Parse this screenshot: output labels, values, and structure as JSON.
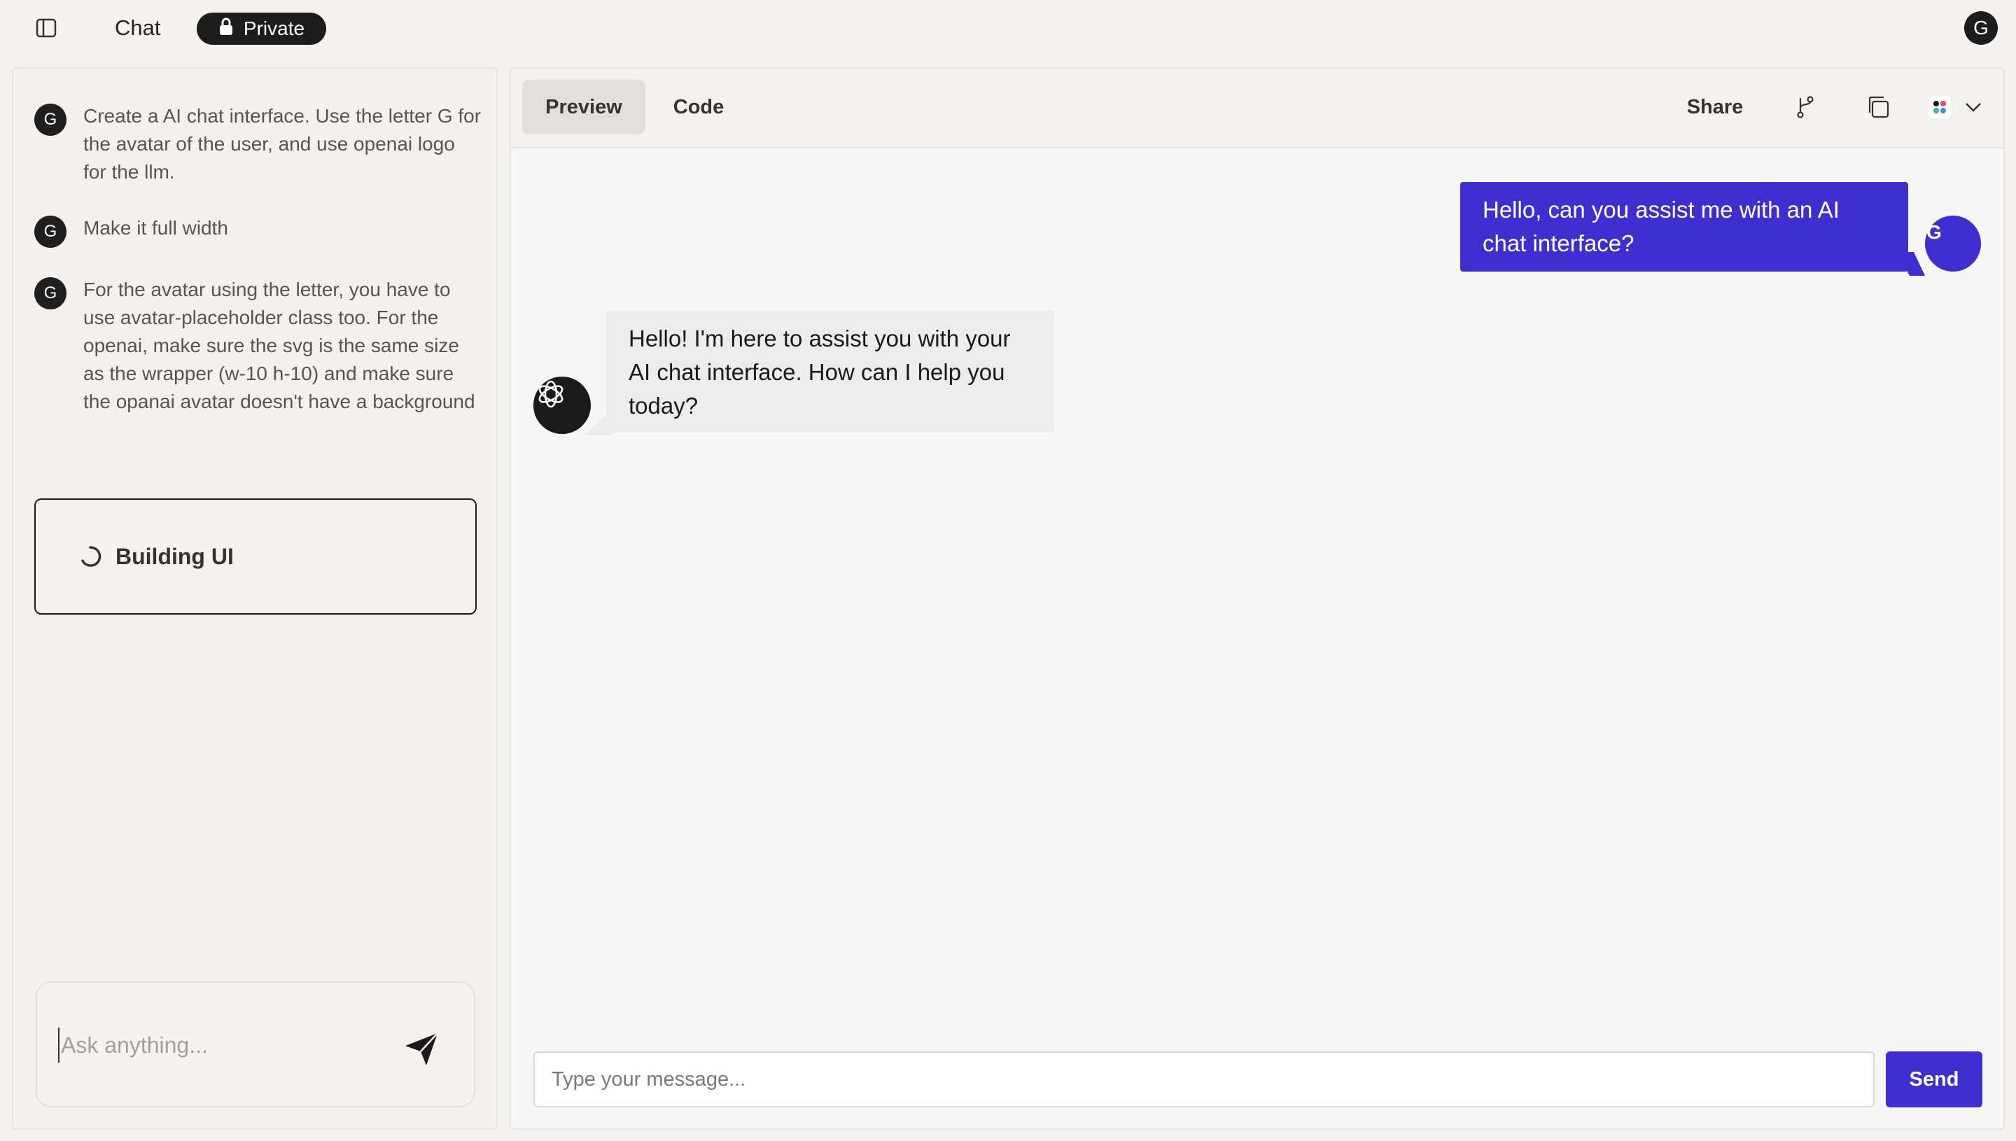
{
  "topbar": {
    "title": "Chat",
    "private_label": "Private",
    "user_initial": "G"
  },
  "history": [
    {
      "initial": "G",
      "text": "Create a AI chat interface. Use the letter G for the avatar of the user, and use openai logo for the llm."
    },
    {
      "initial": "G",
      "text": "Make it full width"
    },
    {
      "initial": "G",
      "text": "For the avatar using the letter, you have to use avatar-placeholder class too. For the openai, make sure the svg is the same size as the wrapper (w-10 h-10) and make sure the opanai avatar doesn't have a background"
    }
  ],
  "status": {
    "label": "Building UI"
  },
  "ask": {
    "placeholder": "Ask anything..."
  },
  "toolbar": {
    "tabs": [
      "Preview",
      "Code"
    ],
    "share_label": "Share"
  },
  "preview": {
    "user_message": "Hello, can you assist me with an AI chat interface?",
    "user_initial": "G",
    "bot_message": "Hello! I'm here to assist you with your AI chat interface. How can I help you today?",
    "input_placeholder": "Type your message...",
    "send_label": "Send"
  },
  "colors": {
    "accent": "#3f2fd0",
    "dark": "#1c1c1c",
    "background": "#f4f3f0"
  }
}
